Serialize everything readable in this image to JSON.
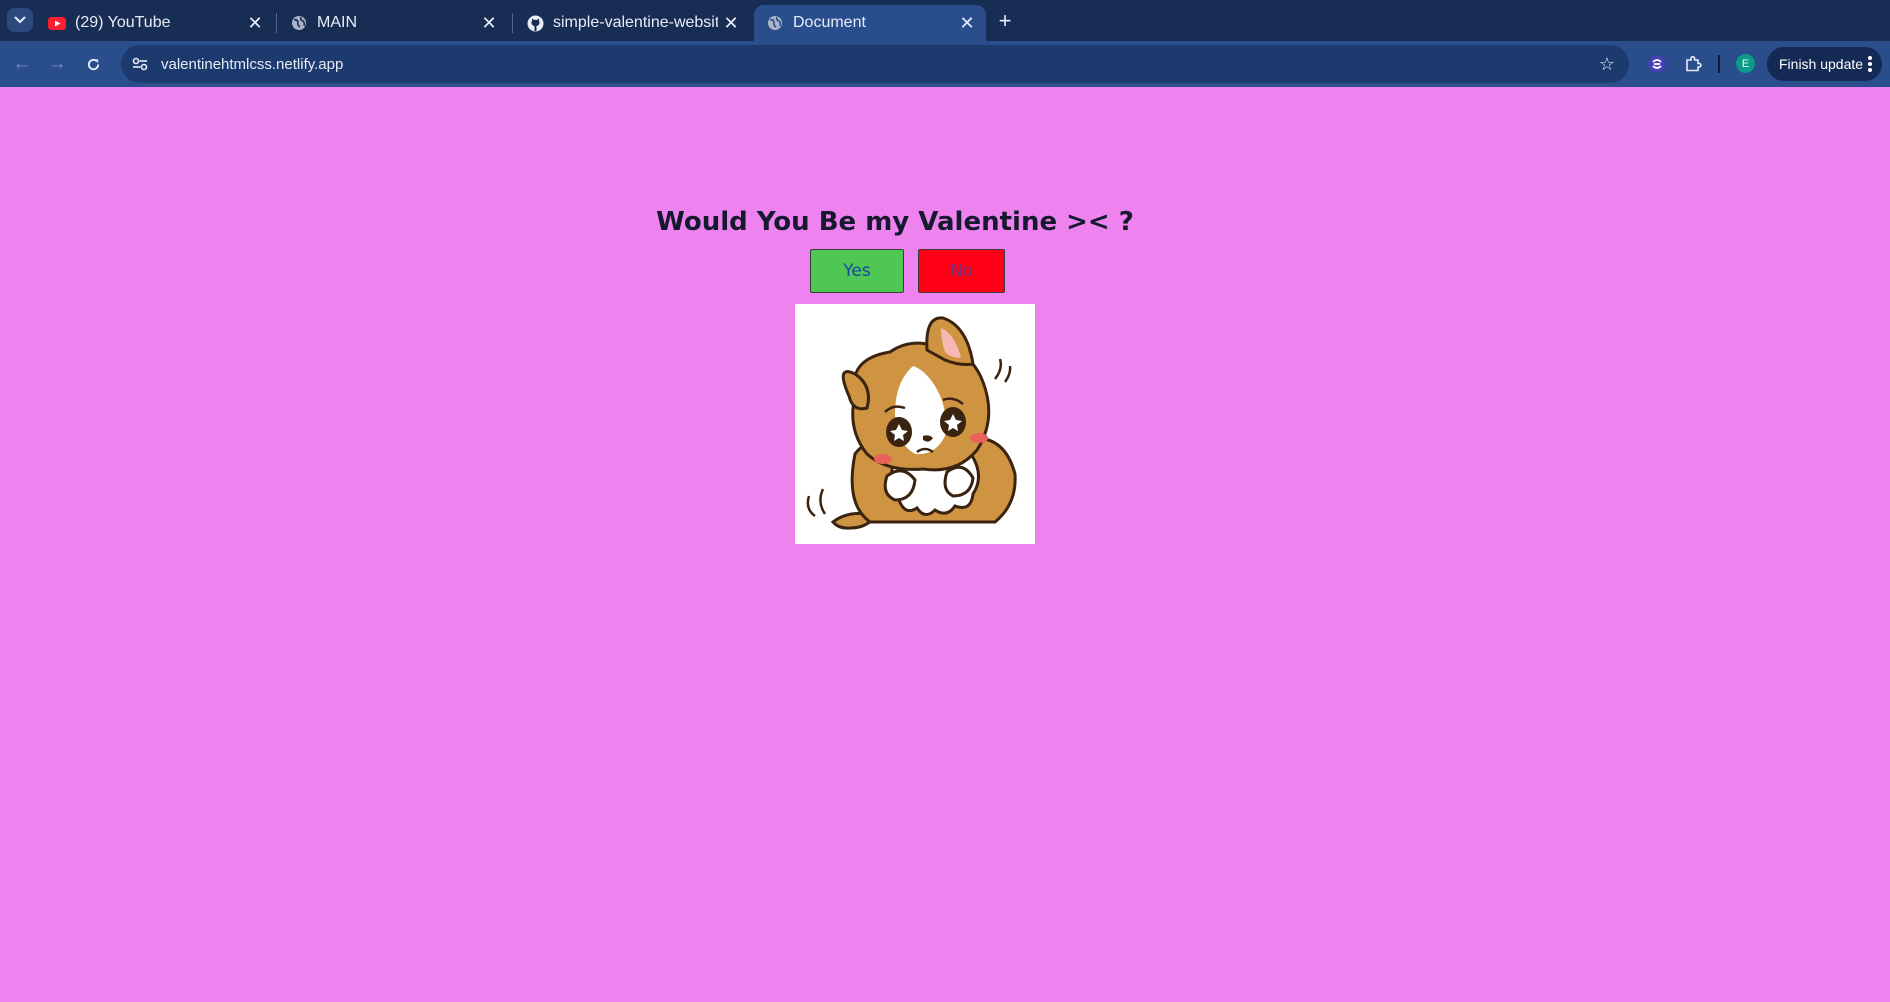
{
  "browser": {
    "tabs": [
      {
        "title": "(29) YouTube",
        "favicon": "youtube-icon",
        "active": false
      },
      {
        "title": "MAIN",
        "favicon": "globe-icon",
        "active": false
      },
      {
        "title": "simple-valentine-website",
        "favicon": "github-icon",
        "active": false
      },
      {
        "title": "Document",
        "favicon": "globe-icon",
        "active": true
      }
    ],
    "address_bar": {
      "url": "valentinehtmlcss.netlify.app"
    },
    "profile_initial": "E",
    "finish_update_label": "Finish update"
  },
  "page": {
    "background_color": "#ee82ee",
    "question": "Would You Be my Valentine >< ?",
    "yes_label": "Yes",
    "no_label": "No",
    "yes_color": "#4fc753",
    "no_color": "#ff0016",
    "illustration": "shy-puppy-image"
  }
}
